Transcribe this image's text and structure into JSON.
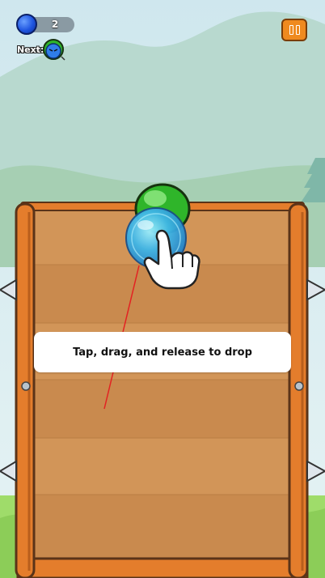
{
  "hud": {
    "ball_count": "2",
    "next_label": "Next:"
  },
  "tutorial": {
    "hint_text": "Tap, drag, and release to drop"
  },
  "icons": {
    "ball_counter_icon": "blue-ball-icon",
    "next_item_icon": "green-blob-character-icon",
    "pause_icon": "pause-icon",
    "hand_icon": "pointing-hand-icon"
  },
  "colors": {
    "sky": "#d8ecf2",
    "hill": "#a9d3b0",
    "grass": "#9fdc6a",
    "crate_inner": "#c98a4e",
    "crate_frame": "#e47d2c",
    "pause_button": "#ef8a1f",
    "drop_ball": "#3fb6e8",
    "trajectory_line": "#e32222"
  }
}
